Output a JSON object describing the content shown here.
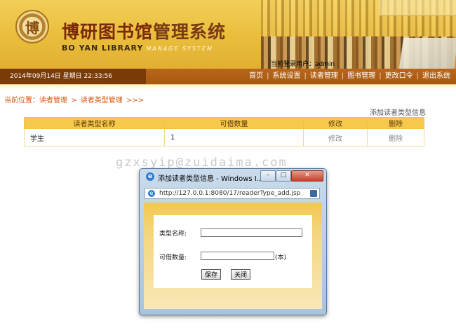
{
  "header": {
    "logo_char": "博",
    "title_cn_art": "博研图书馆",
    "title_cn_normal": "管理系统",
    "title_en": "BO YAN LIBRARY",
    "title_en_sub": "MANAGE SYSTEM",
    "login_label": "当前登录用户：admin"
  },
  "navbar": {
    "datetime": "2014年09月14日  星期日  22:33:56",
    "menu": [
      "首页",
      "系统设置",
      "读者管理",
      "图书管理",
      "更改口令",
      "退出系统"
    ],
    "separator": "|"
  },
  "breadcrumb": {
    "prefix": "当前位置：",
    "items": [
      "读者管理",
      "读者类型管理"
    ],
    "arrow": ">",
    "tail": ">>>"
  },
  "add_link": "添加读者类型信息",
  "table": {
    "headers": [
      "读者类型名称",
      "可借数量",
      "修改",
      "删除"
    ],
    "rows": [
      {
        "name": "学生",
        "count": "1",
        "edit": "修改",
        "delete": "删除"
      }
    ]
  },
  "watermark": "gzxsyip@zuidaima.com",
  "popup": {
    "title": "添加读者类型信息 - Windows I...",
    "url": "http://127.0.0.1:8080/17/readerType_add.jsp",
    "form": {
      "type_name_label": "类型名称:",
      "type_name_value": "",
      "count_label": "可借数量:",
      "count_value": "",
      "unit": "(本)",
      "save_label": "保存",
      "close_label": "关闭"
    }
  },
  "colors": {
    "header_gold": "#e9bd3b",
    "nav_brown": "#a85a12",
    "datetime_bg": "#7a3b08",
    "breadcrumb_orange": "#d25a10",
    "table_header": "#f7c94b"
  }
}
